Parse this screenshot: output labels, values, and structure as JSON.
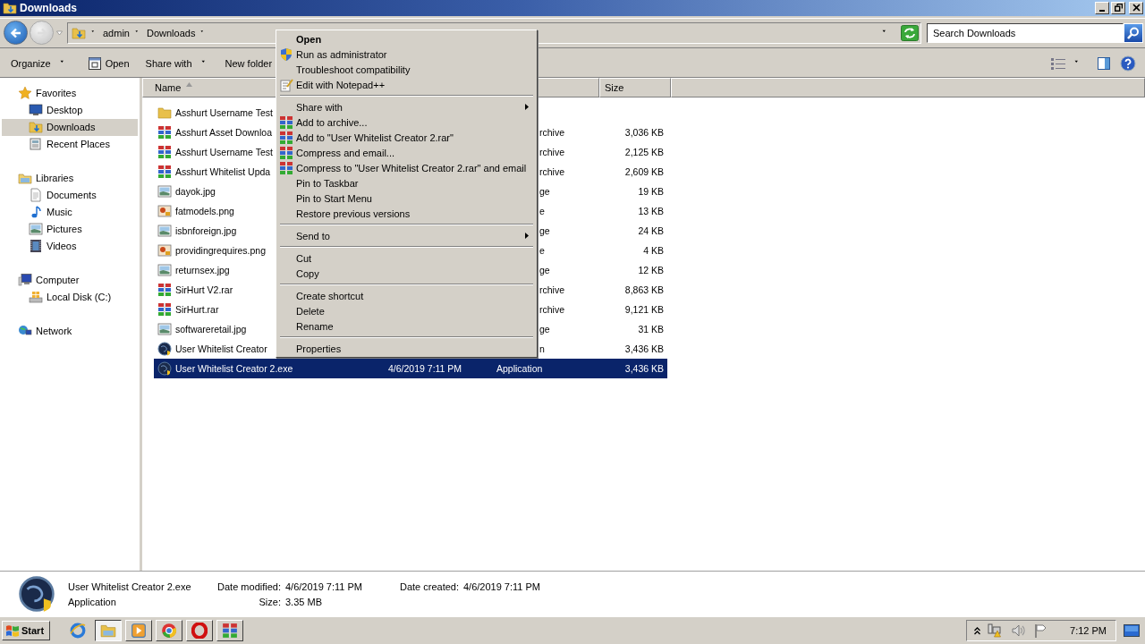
{
  "window": {
    "title": "Downloads"
  },
  "address_bar": {
    "breadcrumb": [
      "admin",
      "Downloads"
    ]
  },
  "search": {
    "placeholder": "Search Downloads"
  },
  "toolbar": {
    "buttons": [
      {
        "label": "Organize",
        "kind": "menu"
      },
      {
        "label": "Open",
        "kind": "open"
      },
      {
        "label": "Share with",
        "kind": "menu"
      },
      {
        "label": "New folder",
        "kind": "plain"
      }
    ]
  },
  "sidebar": {
    "groups": [
      {
        "label": "Favorites",
        "kind": "star",
        "children": [
          {
            "label": "Desktop",
            "kind": "desktop",
            "selected": false
          },
          {
            "label": "Downloads",
            "kind": "downloads",
            "selected": true
          },
          {
            "label": "Recent Places",
            "kind": "recent",
            "selected": false
          }
        ]
      },
      {
        "label": "Libraries",
        "kind": "libraries",
        "children": [
          {
            "label": "Documents",
            "kind": "documents",
            "selected": false
          },
          {
            "label": "Music",
            "kind": "music",
            "selected": false
          },
          {
            "label": "Pictures",
            "kind": "pictures",
            "selected": false
          },
          {
            "label": "Videos",
            "kind": "videos",
            "selected": false
          }
        ]
      },
      {
        "label": "Computer",
        "kind": "computer",
        "children": [
          {
            "label": "Local Disk (C:)",
            "kind": "disk",
            "selected": false
          }
        ]
      },
      {
        "label": "Network",
        "kind": "network"
      }
    ]
  },
  "table": {
    "columns": [
      {
        "label": "Name",
        "sorted": true
      },
      {
        "label": "Size",
        "sorted": false
      }
    ],
    "rows": [
      {
        "name": "Asshurt Username Test",
        "kind": "folder",
        "selected": false
      },
      {
        "name": "Asshurt Asset Downloa",
        "kind": "rar",
        "type": "rchive",
        "size": "3,036 KB",
        "selected": false
      },
      {
        "name": "Asshurt Username Test",
        "kind": "rar",
        "type": "rchive",
        "size": "2,125 KB",
        "selected": false
      },
      {
        "name": "Asshurt Whitelist Upda",
        "kind": "rar",
        "type": "rchive",
        "size": "2,609 KB",
        "selected": false
      },
      {
        "name": "dayok.jpg",
        "kind": "jpg",
        "type": "ge",
        "size": "19 KB",
        "selected": false
      },
      {
        "name": "fatmodels.png",
        "kind": "png",
        "type": "e",
        "size": "13 KB",
        "selected": false
      },
      {
        "name": "isbnforeign.jpg",
        "kind": "jpg",
        "type": "ge",
        "size": "24 KB",
        "selected": false
      },
      {
        "name": "providingrequires.png",
        "kind": "png",
        "type": "e",
        "size": "4 KB",
        "selected": false
      },
      {
        "name": "returnsex.jpg",
        "kind": "jpg",
        "type": "ge",
        "size": "12 KB",
        "selected": false
      },
      {
        "name": "SirHurt V2.rar",
        "kind": "rar",
        "type": "rchive",
        "size": "8,863 KB",
        "selected": false
      },
      {
        "name": "SirHurt.rar",
        "kind": "rar",
        "type": "rchive",
        "size": "9,121 KB",
        "selected": false
      },
      {
        "name": "softwareretail.jpg",
        "kind": "jpg",
        "type": "ge",
        "size": "31 KB",
        "selected": false
      },
      {
        "name": "User Whitelist Creator",
        "kind": "exe",
        "type": "n",
        "size": "3,436 KB",
        "selected": false
      },
      {
        "name": "User Whitelist Creator 2.exe",
        "kind": "exe",
        "date": "4/6/2019 7:11 PM",
        "type": "Application",
        "size": "3,436 KB",
        "selected": true
      }
    ]
  },
  "context_menu": {
    "items": [
      {
        "kind": "plain",
        "label": "Open",
        "default": true
      },
      {
        "kind": "shield",
        "label": "Run as administrator",
        "default": false
      },
      {
        "kind": "plain",
        "label": "Troubleshoot compatibility",
        "default": false
      },
      {
        "kind": "notepad",
        "label": "Edit with Notepad++",
        "default": false
      },
      {
        "kind": "separator"
      },
      {
        "kind": "plain",
        "label": "Share with",
        "submenu": true
      },
      {
        "kind": "archive",
        "label": "Add to archive..."
      },
      {
        "kind": "archive",
        "label": "Add to \"User Whitelist Creator 2.rar\""
      },
      {
        "kind": "archive",
        "label": "Compress and email..."
      },
      {
        "kind": "archive",
        "label": "Compress to \"User Whitelist Creator 2.rar\" and email"
      },
      {
        "kind": "plain",
        "label": "Pin to Taskbar"
      },
      {
        "kind": "plain",
        "label": "Pin to Start Menu"
      },
      {
        "kind": "plain",
        "label": "Restore previous versions"
      },
      {
        "kind": "separator"
      },
      {
        "kind": "plain",
        "label": "Send to",
        "submenu": true
      },
      {
        "kind": "separator"
      },
      {
        "kind": "plain",
        "label": "Cut"
      },
      {
        "kind": "plain",
        "label": "Copy"
      },
      {
        "kind": "separator"
      },
      {
        "kind": "plain",
        "label": "Create shortcut"
      },
      {
        "kind": "plain",
        "label": "Delete"
      },
      {
        "kind": "plain",
        "label": "Rename"
      },
      {
        "kind": "separator"
      },
      {
        "kind": "plain",
        "label": "Properties"
      }
    ]
  },
  "details": {
    "name": "User Whitelist Creator 2.exe",
    "type": "Application",
    "date_modified_label": "Date modified:",
    "date_modified": "4/6/2019 7:11 PM",
    "size_label": "Size:",
    "size": "3.35 MB",
    "date_created_label": "Date created:",
    "date_created": "4/6/2019 7:11 PM"
  },
  "taskbar": {
    "start": "Start",
    "apps": [
      {
        "kind": "browser",
        "active": false
      },
      {
        "kind": "explorer",
        "active": true
      },
      {
        "kind": "media",
        "active": false
      },
      {
        "kind": "chrome",
        "active": false
      },
      {
        "kind": "opera",
        "active": false
      },
      {
        "kind": "rar",
        "active": false
      }
    ],
    "clock": "7:12 PM"
  }
}
